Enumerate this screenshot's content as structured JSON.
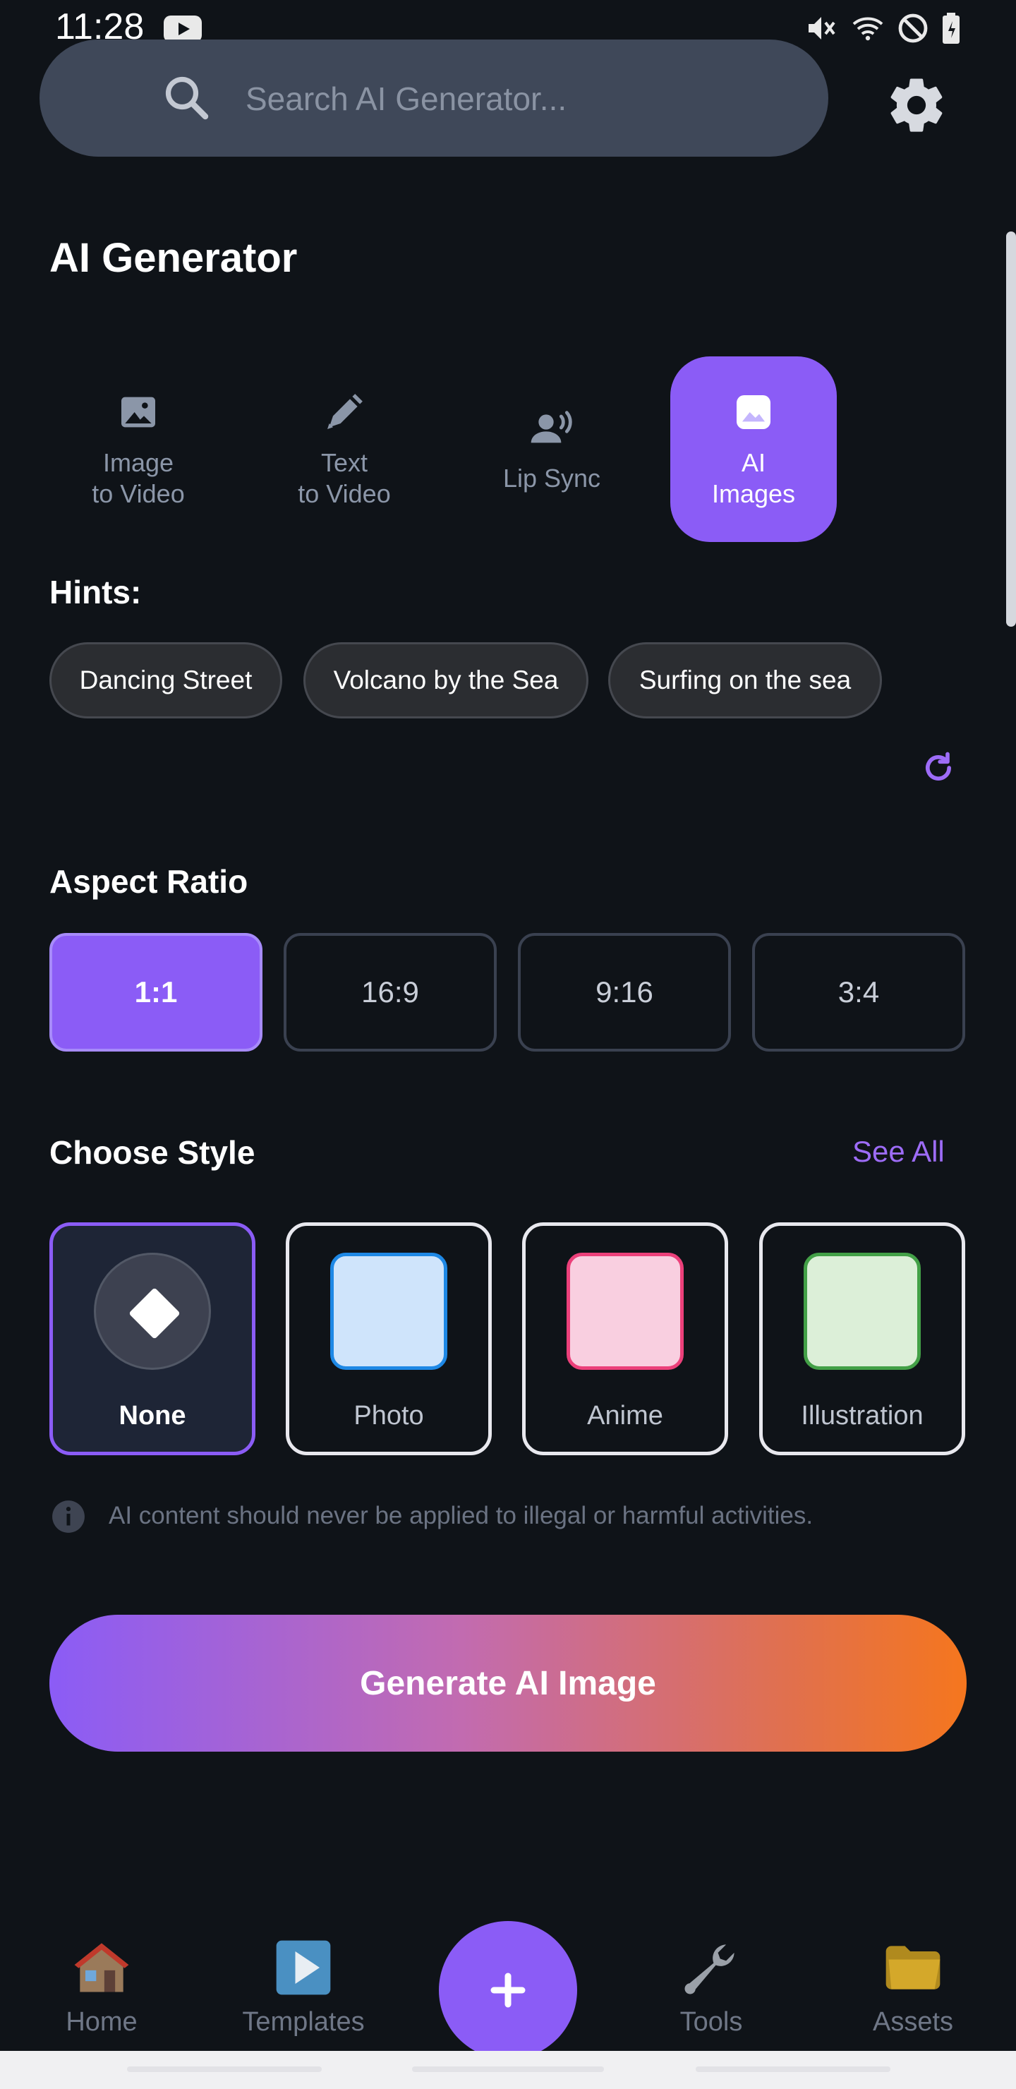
{
  "status": {
    "time": "11:28"
  },
  "search": {
    "placeholder": "Search AI Generator..."
  },
  "header": {
    "title": "AI Generator"
  },
  "modes": [
    {
      "label": "Image\nto Video",
      "icon": "image-icon"
    },
    {
      "label": "Text\nto Video",
      "icon": "pen-icon"
    },
    {
      "label": "Lip Sync",
      "icon": "voice-user-icon"
    },
    {
      "label": "AI\nImages",
      "icon": "ai-image-icon",
      "active": true
    }
  ],
  "hints": {
    "title": "Hints:",
    "chips": [
      "Dancing Street",
      "Volcano by the Sea",
      "Surfing on the sea"
    ]
  },
  "aspect": {
    "title": "Aspect Ratio",
    "options": [
      "1:1",
      "16:9",
      "9:16",
      "3:4"
    ],
    "selected": "1:1"
  },
  "style": {
    "title": "Choose Style",
    "see_all": "See All",
    "cards": [
      {
        "label": "None",
        "selected": true
      },
      {
        "label": "Photo",
        "swatch": "#cfe4fb",
        "border": "#1e88e5"
      },
      {
        "label": "Anime",
        "swatch": "#f9cfe0",
        "border": "#ec407a"
      },
      {
        "label": "Illustration",
        "swatch": "#dcefd8",
        "border": "#43a047"
      }
    ]
  },
  "disclaimer": "AI content should never be applied to illegal or harmful activities.",
  "generate": {
    "label": "Generate AI Image"
  },
  "nav": {
    "items": [
      {
        "label": "Home",
        "icon": "house-icon"
      },
      {
        "label": "Templates",
        "icon": "play-icon"
      },
      {
        "label": "Tools",
        "icon": "wrench-icon"
      },
      {
        "label": "Assets",
        "icon": "folder-icon"
      }
    ],
    "fab": "+"
  },
  "colors": {
    "accent": "#8b5cf6",
    "background": "#0f1318"
  }
}
